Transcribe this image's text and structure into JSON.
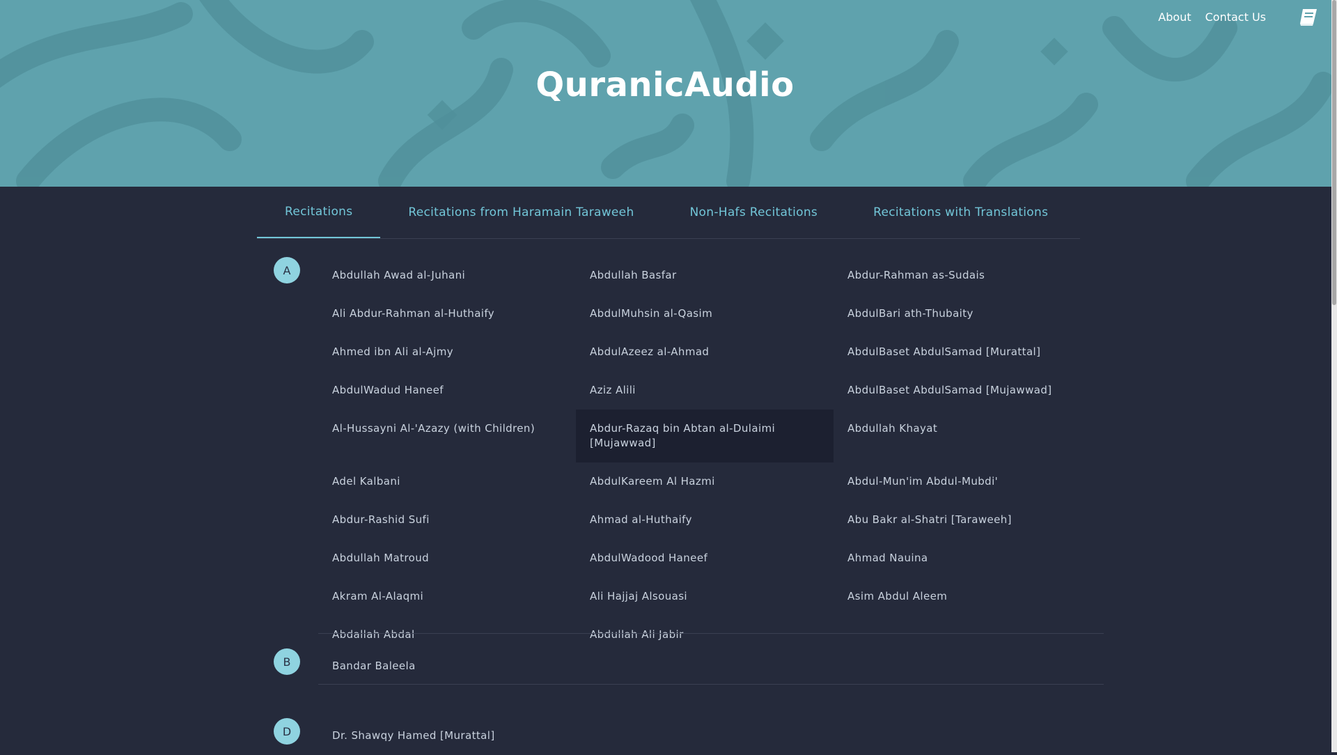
{
  "site": {
    "title": "QuranicAudio"
  },
  "nav": {
    "about": "About",
    "contact": "Contact Us",
    "icon": "book-icon"
  },
  "tabs": [
    {
      "label": "Recitations",
      "active": true
    },
    {
      "label": "Recitations from Haramain Taraweeh",
      "active": false
    },
    {
      "label": "Non-Hafs Recitations",
      "active": false
    },
    {
      "label": "Recitations with Translations",
      "active": false
    }
  ],
  "groups": [
    {
      "letter": "A",
      "reciters": [
        "Abdullah Awad al-Juhani",
        "Abdullah Basfar",
        "Abdur-Rahman as-Sudais",
        "Ali Abdur-Rahman al-Huthaify",
        "AbdulMuhsin al-Qasim",
        "AbdulBari ath-Thubaity",
        "Ahmed ibn Ali al-Ajmy",
        "AbdulAzeez al-Ahmad",
        "AbdulBaset AbdulSamad [Murattal]",
        "AbdulWadud Haneef",
        "Aziz Alili",
        "AbdulBaset AbdulSamad [Mujawwad]",
        "Al-Hussayni Al-'Azazy (with Children)",
        "Abdur-Razaq bin Abtan al-Dulaimi [Mujawwad]",
        "Abdullah Khayat",
        "Adel Kalbani",
        "AbdulKareem Al Hazmi",
        "Abdul-Mun'im Abdul-Mubdi'",
        "Abdur-Rashid Sufi",
        "Ahmad al-Huthaify",
        "Abu Bakr al-Shatri [Taraweeh]",
        "Abdullah Matroud",
        "AbdulWadood Haneef",
        "Ahmad Nauina",
        "Akram Al-Alaqmi",
        "Ali Hajjaj Alsouasi",
        "Asim Abdul Aleem",
        "Abdallah Abdal",
        "Abdullah Ali Jabir"
      ]
    },
    {
      "letter": "B",
      "reciters": [
        "Bandar Baleela"
      ]
    },
    {
      "letter": "D",
      "reciters": [
        "Dr. Shawqy Hamed [Murattal]"
      ]
    }
  ],
  "colors": {
    "hero": "#5fa2ad",
    "body": "#252a3b",
    "accent": "#72c6d8",
    "badge": "#8fd3e0"
  }
}
